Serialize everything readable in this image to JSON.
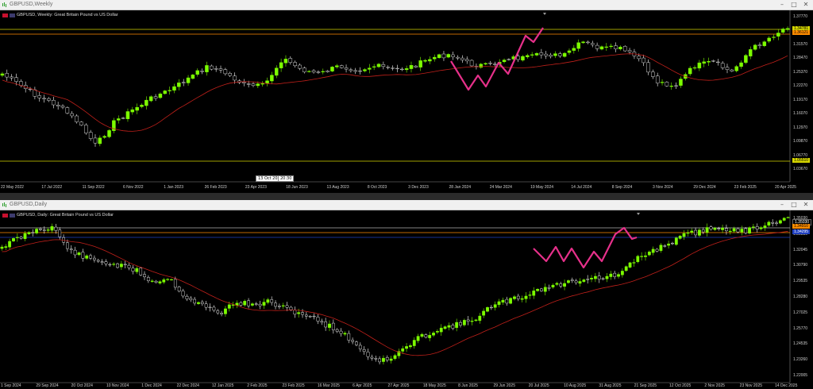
{
  "windows": {
    "weekly": {
      "title": "GBPUSD,Weekly",
      "symbol_label": "GBPUSD, Weekly:  Great Britain Pound vs US Dollar",
      "price_axis": [
        "1.37770",
        "1.34720",
        "1.31570",
        "1.28470",
        "1.25370",
        "1.22270",
        "1.19170",
        "1.16070",
        "1.12970",
        "1.09870",
        "1.06770",
        "1.03670"
      ],
      "price_tags": {
        "upper": "1.34781",
        "orange": "1.36121",
        "lower": "1.05510"
      },
      "time_axis": [
        "22 May 2022",
        "17 Jul 2022",
        "11 Sep 2022",
        "6 Nov 2022",
        "1 Jan 2023",
        "26 Feb 2023",
        "23 Apr 2023",
        "18 Jun 2023",
        "13 Aug 2023",
        "8 Oct 2023",
        "3 Dec 2023",
        "28 Jan 2024",
        "24 Mar 2024",
        "19 May 2024",
        "14 Jul 2024",
        "8 Sep 2024",
        "3 Nov 2024",
        "29 Dec 2024",
        "23 Feb 2025",
        "20 Apr 2025"
      ],
      "crosshair_times": [
        "13 Oct 2023",
        "20:30"
      ]
    },
    "daily": {
      "title": "GBPUSD,Daily",
      "symbol_label": "GBPUSD, Daily:  Great Britain Pound vs US Dollar",
      "price_axis": [
        "1.35030",
        "1.33380",
        "1.32045",
        "1.30790",
        "1.29535",
        "1.28280",
        "1.27025",
        "1.25770",
        "1.24535",
        "1.23260",
        "1.22005"
      ],
      "price_tags": {
        "upper": "1.35030",
        "orange": "1.34910",
        "blue": "1.34295"
      },
      "time_axis": [
        "1 Sep 2024",
        "29 Sep 2024",
        "20 Oct 2024",
        "10 Nov 2024",
        "1 Dec 2024",
        "22 Dec 2024",
        "12 Jan 2025",
        "2 Feb 2025",
        "23 Feb 2025",
        "16 Mar 2025",
        "6 Apr 2025",
        "27 Apr 2025",
        "18 May 2025",
        "8 Jun 2025",
        "29 Jun 2025",
        "20 Jul 2025",
        "10 Aug 2025",
        "31 Aug 2025",
        "21 Sep 2025",
        "12 Oct 2025",
        "2 Nov 2025",
        "23 Nov 2025",
        "14 Dec 2025"
      ]
    }
  },
  "colors": {
    "bull": "#7cfc00",
    "bear": "#ffffff",
    "ma": "#c0201a",
    "zigzag": "#e6308a",
    "hline_yellow": "#d6d600",
    "hline_orange": "#ff8c00",
    "hline_blue": "#1f3fbf"
  },
  "chart_data": [
    {
      "type": "candlestick",
      "title": "GBPUSD, Weekly:  Great Britain Pound vs US Dollar",
      "ylim": [
        1.0367,
        1.3777
      ]
    },
    {
      "type": "candlestick",
      "title": "GBPUSD, Daily:  Great Britain Pound vs US Dollar",
      "ylim": [
        1.22005,
        1.3503
      ]
    }
  ]
}
